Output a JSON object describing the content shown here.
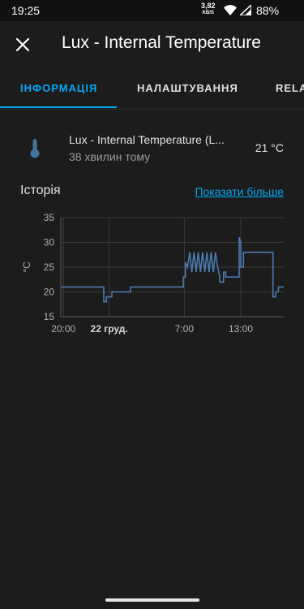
{
  "status_bar": {
    "time": "19:25",
    "net_speed_value": "3,82",
    "net_speed_unit": "KB/S",
    "battery": "88%"
  },
  "app_bar": {
    "title": "Lux - Internal Temperature"
  },
  "tabs": [
    {
      "label": "ІНФОРМАЦІЯ",
      "active": true
    },
    {
      "label": "НАЛАШТУВАННЯ",
      "active": false
    },
    {
      "label": "RELA",
      "active": false
    }
  ],
  "entity": {
    "name": "Lux - Internal Temperature (L...",
    "last_changed": "38 хвилин тому",
    "state": "21 °C",
    "icon": "thermometer-icon"
  },
  "history": {
    "title": "Історія",
    "show_more_label": "Показати більше"
  },
  "chart_data": {
    "type": "line",
    "ylabel": "°C",
    "ylim": [
      15,
      35
    ],
    "yticks": [
      "35",
      "30",
      "25",
      "20",
      "15"
    ],
    "xticks": [
      "20:00",
      "22 груд.",
      "7:00",
      "13:00"
    ],
    "grid": true,
    "color": "#4a7ab0",
    "series": [
      {
        "name": "",
        "points": [
          [
            0.0,
            21
          ],
          [
            8.0,
            21
          ],
          [
            8.0,
            18
          ],
          [
            8.5,
            18
          ],
          [
            8.5,
            19
          ],
          [
            9.5,
            19
          ],
          [
            9.5,
            20
          ],
          [
            13.0,
            20
          ],
          [
            13.0,
            21
          ],
          [
            22.8,
            21
          ],
          [
            22.8,
            23
          ],
          [
            23.2,
            23
          ],
          [
            23.2,
            26
          ],
          [
            23.6,
            25
          ],
          [
            24.0,
            28
          ],
          [
            24.4,
            24
          ],
          [
            24.8,
            28
          ],
          [
            25.2,
            24
          ],
          [
            25.6,
            28
          ],
          [
            26.0,
            24
          ],
          [
            26.4,
            28
          ],
          [
            26.8,
            24
          ],
          [
            27.2,
            28
          ],
          [
            27.6,
            24
          ],
          [
            28.0,
            28
          ],
          [
            28.4,
            24
          ],
          [
            28.8,
            28
          ],
          [
            29.2,
            25
          ],
          [
            29.6,
            23
          ],
          [
            29.6,
            22
          ],
          [
            30.3,
            22
          ],
          [
            30.3,
            24
          ],
          [
            30.7,
            24
          ],
          [
            30.7,
            23
          ],
          [
            33.2,
            23
          ],
          [
            33.2,
            31
          ],
          [
            33.5,
            30
          ],
          [
            33.5,
            25
          ],
          [
            34.0,
            25
          ],
          [
            34.0,
            28
          ],
          [
            39.5,
            28
          ],
          [
            39.5,
            19
          ],
          [
            40.0,
            19
          ],
          [
            40.0,
            20
          ],
          [
            40.5,
            20
          ],
          [
            40.5,
            21
          ],
          [
            41.5,
            21
          ]
        ]
      }
    ]
  },
  "colors": {
    "accent": "#03a9f4",
    "background": "#1c1c1c",
    "status_bar": "#111111",
    "line": "#4a7ab0"
  }
}
